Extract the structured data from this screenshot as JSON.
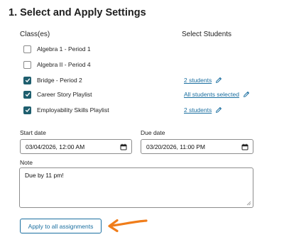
{
  "section": {
    "title": "1. Select and Apply Settings"
  },
  "headers": {
    "classes": "Class(es)",
    "students": "Select Students"
  },
  "classes": [
    {
      "label": "Algebra 1 - Period 1",
      "checked": false
    },
    {
      "label": "Algebra II - Period 4",
      "checked": false
    },
    {
      "label": "Bridge - Period 2",
      "checked": true,
      "students": "2 students"
    },
    {
      "label": "Career Story Playlist",
      "checked": true,
      "students": "All students selected"
    },
    {
      "label": "Employability Skills Playlist",
      "checked": true,
      "students": "2 students"
    }
  ],
  "start_date": {
    "label": "Start date",
    "value": "03/04/2026, 12:00 AM"
  },
  "due_date": {
    "label": "Due date",
    "value": "03/20/2026, 11:00 PM"
  },
  "note": {
    "label": "Note",
    "value": "Due by 11 pm!"
  },
  "apply_button": {
    "label": "Apply to all assignments"
  },
  "colors": {
    "accent": "#1e5e6e",
    "link": "#1b6fa0",
    "arrow": "#f07d1a"
  },
  "icons": {
    "pencil": "pencil-icon",
    "calendar": "calendar-icon",
    "checkmark": "checkmark-icon",
    "arrow": "arrow-icon"
  }
}
